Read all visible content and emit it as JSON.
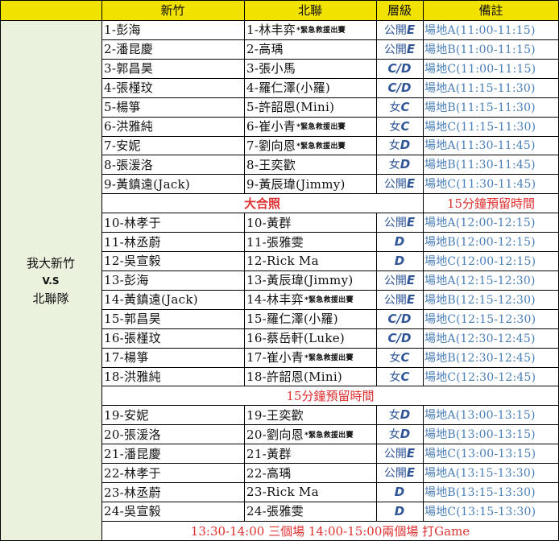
{
  "header": {
    "col1": "新竹",
    "col2": "北聯",
    "col3": "層級",
    "col4": "備註"
  },
  "side_label": {
    "line1": "我大新竹",
    "line2": "V.S",
    "line3": "北聯隊"
  },
  "block1": [
    {
      "a": "1-彭海",
      "b": "1-林丰弈",
      "note": "*緊急救援出賽",
      "lvl_cn": "公開",
      "lvl": "E",
      "rmk": "場地A(11:00-11:15)"
    },
    {
      "a": "2-潘昆慶",
      "b": "2-高瑀",
      "note": "",
      "lvl_cn": "公開",
      "lvl": "E",
      "rmk": "場地B(11:00-11:15)"
    },
    {
      "a": "3-郭昌昊",
      "b": "3-張小馬",
      "note": "",
      "lvl_cn": "",
      "lvl": "C/D",
      "rmk": "場地C(11:00-11:15)"
    },
    {
      "a": "4-張槿玟",
      "b": "4-羅仁澤(小羅)",
      "note": "",
      "lvl_cn": "",
      "lvl": "C/D",
      "rmk": "場地A(11:15-11:30)"
    },
    {
      "a": "5-楊箏",
      "b": "5-許韶恩(Mini)",
      "note": "",
      "lvl_cn": "女",
      "lvl": "C",
      "rmk": "場地B(11:15-11:30)"
    },
    {
      "a": "6-洪雅純",
      "b": "6-崔小青",
      "note": "*緊急救援出賽",
      "lvl_cn": "女",
      "lvl": "C",
      "rmk": "場地C(11:15-11:30)"
    },
    {
      "a": "7-安妮",
      "b": "7-劉向恩",
      "note": "*緊急救援出賽",
      "lvl_cn": "女",
      "lvl": "D",
      "rmk": "場地A(11:30-11:45)"
    },
    {
      "a": "8-張湲洛",
      "b": "8-王奕歡",
      "note": "",
      "lvl_cn": "女",
      "lvl": "D",
      "rmk": "場地B(11:30-11:45)"
    },
    {
      "a": "9-黃鎮遠(Jack)",
      "b": "9-黃辰瑋(Jimmy)",
      "note": "",
      "lvl_cn": "公開",
      "lvl": "E",
      "rmk": "場地C(11:30-11:45)"
    }
  ],
  "banner1": {
    "left": "大合照",
    "right": "15分鐘預留時間"
  },
  "block2": [
    {
      "a": "10-林孝于",
      "b": "10-黃群",
      "note": "",
      "lvl_cn": "公開",
      "lvl": "E",
      "rmk": "場地A(12:00-12:15)"
    },
    {
      "a": "11-林丞蔚",
      "b": "11-張雅雯",
      "note": "",
      "lvl_cn": "",
      "lvl": "D",
      "rmk": "場地B(12:00-12:15)"
    },
    {
      "a": "12-吳宣毅",
      "b": "12-Rick Ma",
      "note": "",
      "lvl_cn": "",
      "lvl": "D",
      "rmk": "場地C(12:00-12:15)"
    },
    {
      "a": "13-彭海",
      "b": "13-黃辰瑋(Jimmy)",
      "note": "",
      "lvl_cn": "公開",
      "lvl": "E",
      "rmk": "場地A(12:15-12:30)"
    },
    {
      "a": "14-黃鎮遠(Jack)",
      "b": "14-林丰弈",
      "note": "*緊急救援出賽",
      "lvl_cn": "公開",
      "lvl": "E",
      "rmk": "場地B(12:15-12:30)"
    },
    {
      "a": "15-郭昌昊",
      "b": "15-羅仁澤(小羅)",
      "note": "",
      "lvl_cn": "",
      "lvl": "C/D",
      "rmk": "場地C(12:15-12:30)"
    },
    {
      "a": "16-張槿玟",
      "b": "16-蔡岳軒(Luke)",
      "note": "",
      "lvl_cn": "",
      "lvl": "C/D",
      "rmk": "場地A(12:30-12:45)"
    },
    {
      "a": "17-楊箏",
      "b": "17-崔小青",
      "note": "*緊急救援出賽",
      "lvl_cn": "女",
      "lvl": "C",
      "rmk": "場地B(12:30-12:45)"
    },
    {
      "a": "18-洪雅純",
      "b": "18-許韶恩(Mini)",
      "note": "",
      "lvl_cn": "女",
      "lvl": "C",
      "rmk": "場地C(12:30-12:45)"
    }
  ],
  "banner2": {
    "text": "15分鐘預留時間"
  },
  "block3": [
    {
      "a": "19-安妮",
      "b": "19-王奕歡",
      "note": "",
      "lvl_cn": "女",
      "lvl": "D",
      "rmk": "場地A(13:00-13:15)"
    },
    {
      "a": "20-張湲洛",
      "b": "20-劉向恩",
      "note": "*緊急救援出賽",
      "lvl_cn": "女",
      "lvl": "D",
      "rmk": "場地B(13:00-13:15)"
    },
    {
      "a": "21-潘昆慶",
      "b": "21-黃群",
      "note": "",
      "lvl_cn": "公開",
      "lvl": "E",
      "rmk": "場地C(13:00-13:15)"
    },
    {
      "a": "22-林孝于",
      "b": "22-高瑀",
      "note": "",
      "lvl_cn": "公開",
      "lvl": "E",
      "rmk": "場地A(13:15-13:30)"
    },
    {
      "a": "23-林丞蔚",
      "b": "23-Rick Ma",
      "note": "",
      "lvl_cn": "",
      "lvl": "D",
      "rmk": "場地B(13:15-13:30)"
    },
    {
      "a": "24-吳宣毅",
      "b": "24-張雅雯",
      "note": "",
      "lvl_cn": "",
      "lvl": "D",
      "rmk": "場地C(13:15-13:30)"
    }
  ],
  "footer": {
    "text": "13:30-14:00 三個場 14:00-15:00兩個場 打Game"
  }
}
